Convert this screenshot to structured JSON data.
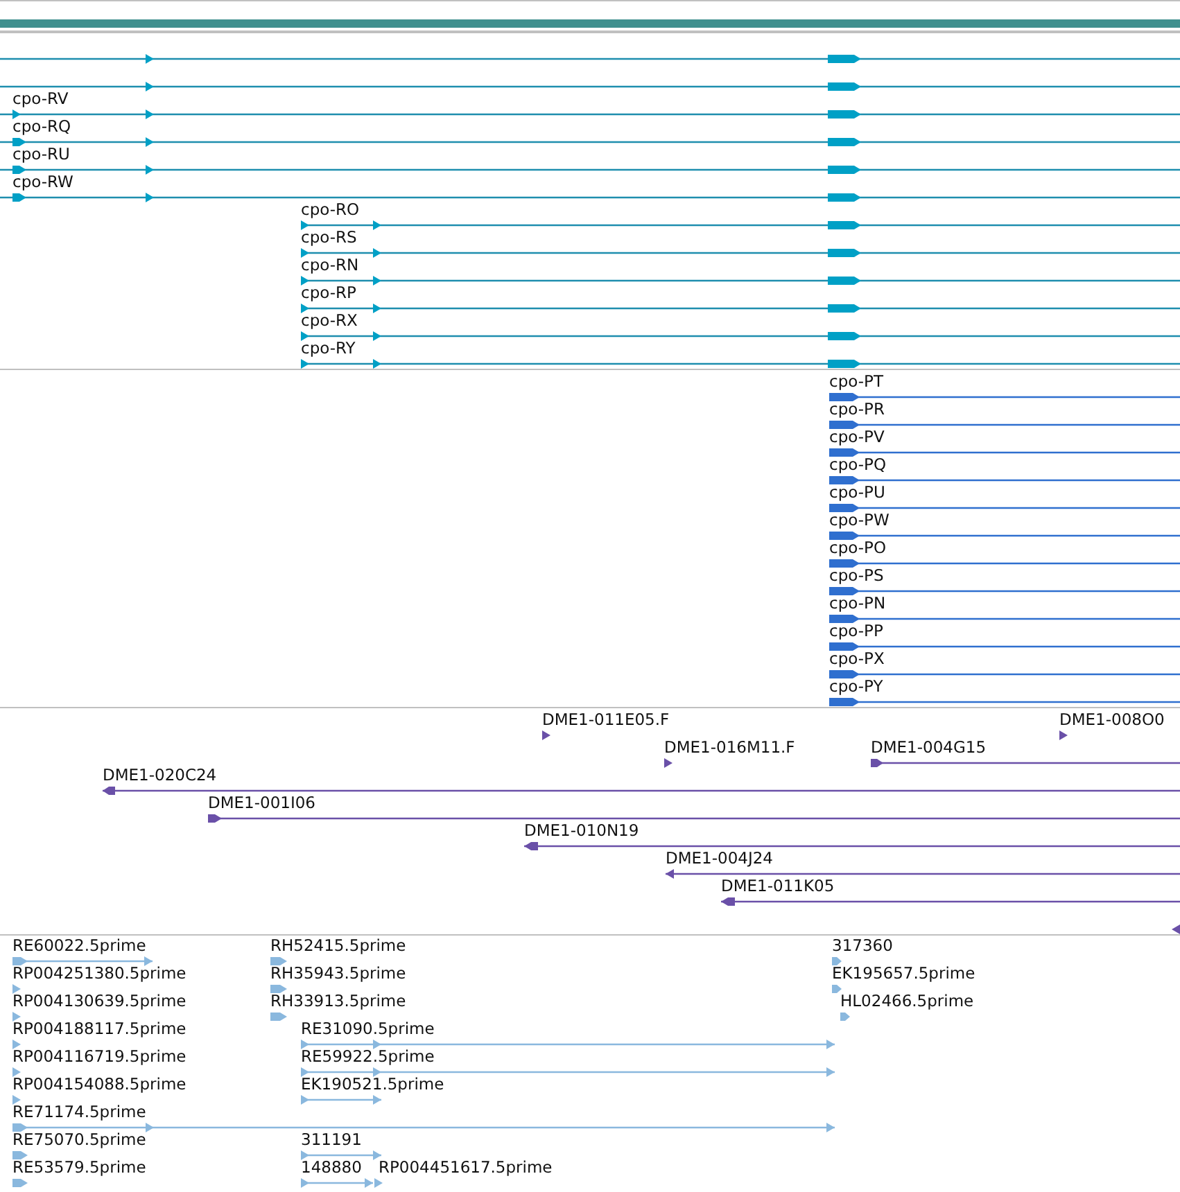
{
  "tracks": [
    {
      "kind": "gene",
      "features": [
        {
          "reverse": false
        },
        {
          "reverse": false
        },
        {
          "label": "cpo-RV",
          "reverse": false
        },
        {
          "label": "cpo-RQ",
          "reverse": false
        },
        {
          "label": "cpo-RU",
          "reverse": false
        },
        {
          "label": "cpo-RW",
          "reverse": false
        },
        {
          "label": "cpo-RO",
          "reverse": false
        },
        {
          "label": "cpo-RS",
          "reverse": false
        },
        {
          "label": "cpo-RN",
          "reverse": false
        },
        {
          "label": "cpo-RP",
          "reverse": false
        },
        {
          "label": "cpo-RX",
          "reverse": false
        },
        {
          "label": "cpo-RY",
          "reverse": false
        }
      ]
    },
    {
      "kind": "transcript",
      "features": [
        {
          "label": "cpo-PT",
          "reverse": false
        },
        {
          "label": "cpo-PR",
          "reverse": false
        },
        {
          "label": "cpo-PV",
          "reverse": false
        },
        {
          "label": "cpo-PQ",
          "reverse": false
        },
        {
          "label": "cpo-PU",
          "reverse": false
        },
        {
          "label": "cpo-PW",
          "reverse": false
        },
        {
          "label": "cpo-PO",
          "reverse": false
        },
        {
          "label": "cpo-PS",
          "reverse": false
        },
        {
          "label": "cpo-PN",
          "reverse": false
        },
        {
          "label": "cpo-PP",
          "reverse": false
        },
        {
          "label": "cpo-PX",
          "reverse": false
        },
        {
          "label": "cpo-PY",
          "reverse": false
        }
      ]
    },
    {
      "kind": "clone",
      "features": [
        {
          "label": "DME1-011E05.F",
          "reverse": false
        },
        {
          "label": "DME1-008O0",
          "reverse": false
        },
        {
          "label": "DME1-016M11.F",
          "reverse": false
        },
        {
          "label": "DME1-004G15",
          "reverse": false
        },
        {
          "label": "DME1-020C24",
          "reverse": true
        },
        {
          "label": "DME1-001I06",
          "reverse": false
        },
        {
          "label": "DME1-010N19",
          "reverse": true
        },
        {
          "label": "DME1-004J24",
          "reverse": true
        },
        {
          "label": "DME1-011K05",
          "reverse": true
        },
        {
          "reverse": true
        }
      ]
    },
    {
      "kind": "est",
      "features": [
        {
          "label": "RE60022.5prime",
          "reverse": false
        },
        {
          "label": "RH52415.5prime",
          "reverse": false
        },
        {
          "label": "317360",
          "reverse": false
        },
        {
          "label": "RP004251380.5prime",
          "reverse": false
        },
        {
          "label": "RH35943.5prime",
          "reverse": false
        },
        {
          "label": "EK195657.5prime",
          "reverse": false
        },
        {
          "label": "RP004130639.5prime",
          "reverse": false
        },
        {
          "label": "RH33913.5prime",
          "reverse": false
        },
        {
          "label": "HL02466.5prime",
          "reverse": false
        },
        {
          "label": "RP004188117.5prime",
          "reverse": false
        },
        {
          "label": "RE31090.5prime",
          "reverse": false
        },
        {
          "label": "RP004116719.5prime",
          "reverse": false
        },
        {
          "label": "RE59922.5prime",
          "reverse": false
        },
        {
          "label": "RP004154088.5prime",
          "reverse": false
        },
        {
          "label": "EK190521.5prime",
          "reverse": false
        },
        {
          "label": "RE71174.5prime",
          "reverse": false
        },
        {
          "label": "RE75070.5prime",
          "reverse": false
        },
        {
          "label": "311191",
          "reverse": false
        },
        {
          "label": "RE53579.5prime",
          "reverse": false
        },
        {
          "label": "148880",
          "reverse": false
        },
        {
          "label": "RP004451617.5prime",
          "reverse": false
        }
      ]
    }
  ]
}
